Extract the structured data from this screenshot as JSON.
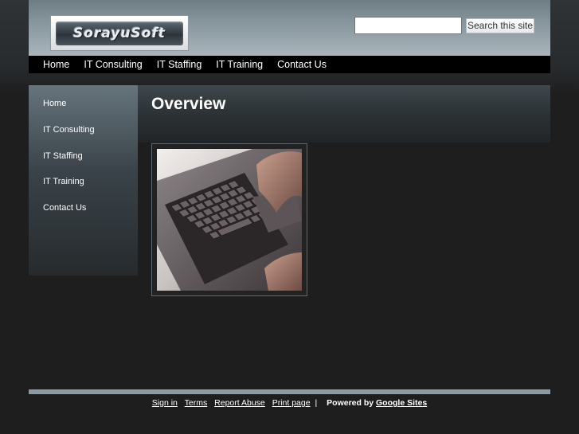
{
  "site": {
    "logo_text": "SorayuSoft"
  },
  "search": {
    "value": "",
    "button_label": "Search this site"
  },
  "topnav": {
    "items": [
      {
        "label": "Home"
      },
      {
        "label": "IT Consulting"
      },
      {
        "label": "IT Staffing"
      },
      {
        "label": "IT Training"
      },
      {
        "label": "Contact Us"
      }
    ]
  },
  "sidebar": {
    "items": [
      {
        "label": "Home"
      },
      {
        "label": "IT Consulting"
      },
      {
        "label": "IT Staffing"
      },
      {
        "label": "IT Training"
      },
      {
        "label": "Contact Us"
      }
    ]
  },
  "main": {
    "title": "Overview"
  },
  "footer": {
    "sign_in": "Sign in",
    "terms": "Terms",
    "report_abuse": "Report Abuse",
    "print_page": "Print page",
    "separator": "|",
    "powered_by": "Powered by",
    "google_sites": "Google Sites"
  },
  "colors": {
    "page_bg": "#1e1e1e",
    "header_accent": "#8a989f",
    "nav_bg": "#000000",
    "footer_bar": "#8d9aa1"
  }
}
